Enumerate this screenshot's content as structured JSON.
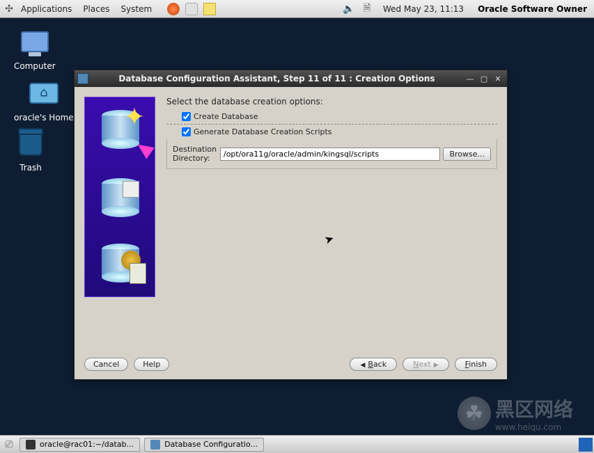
{
  "topbar": {
    "apps_icon": "apps",
    "menu": [
      "Applications",
      "Places",
      "System"
    ],
    "clock": "Wed May 23, 11:13",
    "owner": "Oracle Software Owner"
  },
  "desktop": {
    "computer": "Computer",
    "home": "oracle's Home",
    "trash": "Trash"
  },
  "window": {
    "title": "Database Configuration Assistant, Step 11 of 11 : Creation Options",
    "heading": "Select the database creation options:",
    "create_db_label": "Create Database",
    "create_db_checked": true,
    "gen_scripts_label": "Generate Database Creation Scripts",
    "gen_scripts_checked": true,
    "dest_label": "Destination Directory:",
    "dest_value": "/opt/ora11g/oracle/admin/kingsql/scripts",
    "browse_label": "Browse...",
    "buttons": {
      "cancel": "Cancel",
      "help": "Help",
      "back": "Back",
      "next": "Next",
      "finish": "Finish"
    }
  },
  "taskbar": {
    "item1": "oracle@rac01:~/datab...",
    "item2": "Database Configuratio..."
  },
  "watermark": {
    "brand": "黑区网络",
    "url": "www.heiqu.com"
  }
}
